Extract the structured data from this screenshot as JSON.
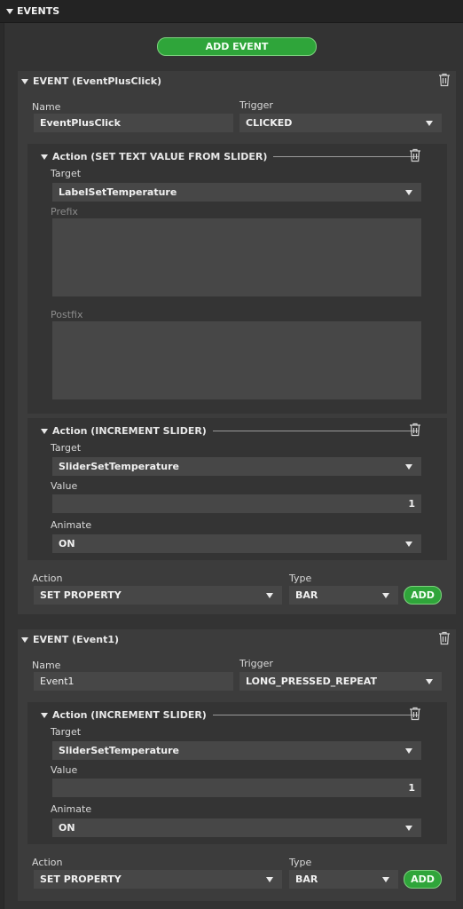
{
  "header": {
    "title": "EVENTS"
  },
  "add_event_label": "ADD EVENT",
  "events": [
    {
      "title": "EVENT (EventPlusClick)",
      "name_label": "Name",
      "name_value": "EventPlusClick",
      "trigger_label": "Trigger",
      "trigger_value": "CLICKED",
      "actions": [
        {
          "title": "Action (SET TEXT VALUE FROM SLIDER)",
          "target_label": "Target",
          "target_value": "LabelSetTemperature",
          "prefix_label": "Prefix",
          "postfix_label": "Postfix"
        },
        {
          "title": "Action (INCREMENT SLIDER)",
          "target_label": "Target",
          "target_value": "SliderSetTemperature",
          "value_label": "Value",
          "value_value": "1",
          "animate_label": "Animate",
          "animate_value": "ON"
        }
      ],
      "footer": {
        "action_label": "Action",
        "action_value": "SET PROPERTY",
        "type_label": "Type",
        "type_value": "BAR",
        "add_label": "ADD"
      }
    },
    {
      "title": "EVENT (Event1)",
      "name_label": "Name",
      "name_value": "Event1",
      "trigger_label": "Trigger",
      "trigger_value": "LONG_PRESSED_REPEAT",
      "actions": [
        {
          "title": "Action (INCREMENT SLIDER)",
          "target_label": "Target",
          "target_value": "SliderSetTemperature",
          "value_label": "Value",
          "value_value": "1",
          "animate_label": "Animate",
          "animate_value": "ON"
        }
      ],
      "footer": {
        "action_label": "Action",
        "action_value": "SET PROPERTY",
        "type_label": "Type",
        "type_value": "BAR",
        "add_label": "ADD"
      }
    }
  ],
  "icons": {
    "collapse": "triangle-down-icon",
    "delete": "trash-icon",
    "dropdown": "chevron-down-icon"
  },
  "colors": {
    "accent_green": "#2fa53a",
    "panel_bg": "#333333",
    "event_bg": "#3c3c3c",
    "field_bg": "#474747"
  }
}
